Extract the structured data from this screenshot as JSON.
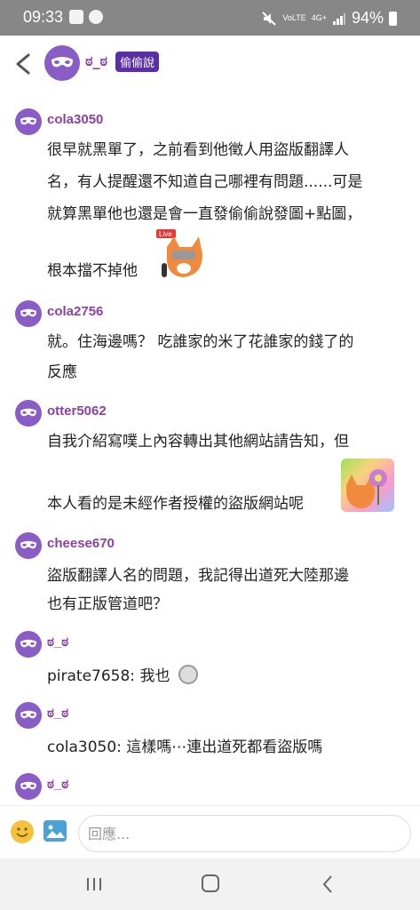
{
  "status_bar": {
    "time": "09:33",
    "network": "4G+",
    "volte": "VoLTE",
    "battery": "94%"
  },
  "header": {
    "title": "ಠ_ಠ",
    "badge": "偷偷說"
  },
  "messages": [
    {
      "user": "cola3050",
      "lines": [
        "很早就黑單了，之前看到他徵人用盜版翻譯人",
        "名，有人提醒還不知道自己哪裡有問題......可是",
        "就算黑單他也還是會一直發偷偷說發圖+點圖，",
        "根本擋不掉他"
      ],
      "sticker": {
        "name": "fox-live-sticker",
        "label": "Live"
      }
    },
    {
      "user": "cola2756",
      "lines": [
        "就。住海邊嗎？ 吃誰家的米了花誰家的錢了的",
        "反應"
      ]
    },
    {
      "user": "otter5062",
      "lines": [
        "自我介紹寫噗上內容轉出其他網站請告知，但",
        "本人看的是未經作者授權的盜版網站呢"
      ],
      "sticker": {
        "name": "fox-flower-sticker"
      }
    },
    {
      "user": "cheese670",
      "lines": [
        "盜版翻譯人名的問題，我記得出道死大陸那邊",
        "也有正版管道吧？"
      ]
    },
    {
      "user": "ಠ_ಠ",
      "lines": [
        "pirate7658: 我也"
      ]
    },
    {
      "user": "ಠ_ಠ",
      "lines": [
        "cola3050: 這樣嗎⋯連出道死都看盜版嗎"
      ]
    },
    {
      "user": "ಠ_ಠ",
      "lines": []
    }
  ],
  "input": {
    "placeholder": "回應..."
  }
}
